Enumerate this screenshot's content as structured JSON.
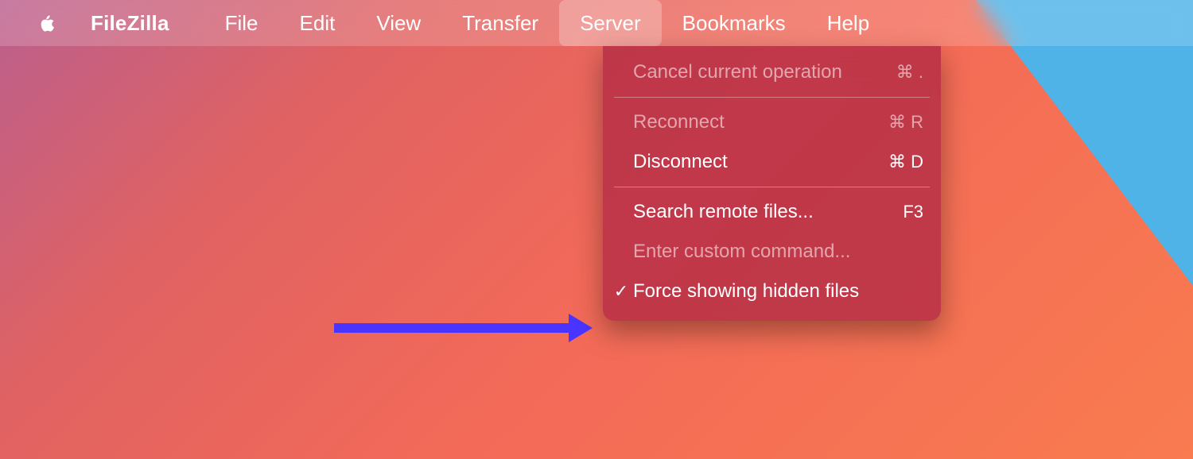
{
  "menubar": {
    "app_name": "FileZilla",
    "items": [
      {
        "label": "File"
      },
      {
        "label": "Edit"
      },
      {
        "label": "View"
      },
      {
        "label": "Transfer"
      },
      {
        "label": "Server",
        "active": true
      },
      {
        "label": "Bookmarks"
      },
      {
        "label": "Help"
      }
    ]
  },
  "server_menu": {
    "items": [
      {
        "label": "Cancel current operation",
        "shortcut": "⌘ .",
        "enabled": false
      },
      {
        "separator": true
      },
      {
        "label": "Reconnect",
        "shortcut": "⌘ R",
        "enabled": false
      },
      {
        "label": "Disconnect",
        "shortcut": "⌘ D",
        "enabled": true
      },
      {
        "separator": true
      },
      {
        "label": "Search remote files...",
        "shortcut": "F3",
        "enabled": true
      },
      {
        "label": "Enter custom command...",
        "shortcut": "",
        "enabled": false
      },
      {
        "label": "Force showing hidden files",
        "shortcut": "",
        "enabled": true,
        "checked": true
      }
    ]
  },
  "annotation": {
    "arrow_color": "#4a34ff"
  }
}
